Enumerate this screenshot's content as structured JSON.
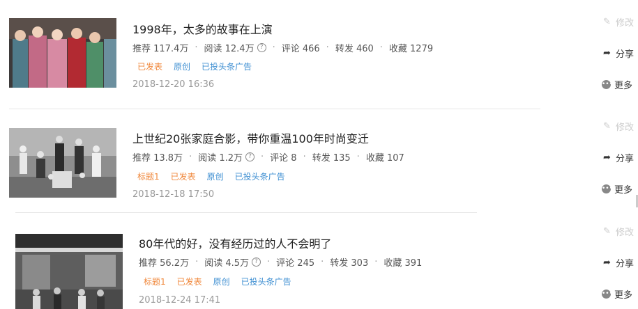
{
  "articles": [
    {
      "title": "1998年，太多的故事在上演",
      "stats": {
        "recommend": "推荐 117.4万",
        "read": "阅读 12.4万",
        "comment": "评论 466",
        "forward": "转发 460",
        "favorite": "收藏 1279"
      },
      "tags": [
        "已发表",
        "原创",
        "已投头条广告"
      ],
      "tag_colors": [
        "orange",
        "blue",
        "blue"
      ],
      "date": "2018-12-20 16:36"
    },
    {
      "title": "上世纪20张家庭合影，带你重温100年时尚变迁",
      "stats": {
        "recommend": "推荐 13.8万",
        "read": "阅读 1.2万",
        "comment": "评论 8",
        "forward": "转发 135",
        "favorite": "收藏 107"
      },
      "tags": [
        "标题1",
        "已发表",
        "原创",
        "已投头条广告"
      ],
      "tag_colors": [
        "orange",
        "orange",
        "blue",
        "blue"
      ],
      "date": "2018-12-18 17:50"
    },
    {
      "title": "80年代的好，没有经历过的人不会明了",
      "stats": {
        "recommend": "推荐 56.2万",
        "read": "阅读 4.5万",
        "comment": "评论 245",
        "forward": "转发 303",
        "favorite": "收藏 391"
      },
      "tags": [
        "标题1",
        "已发表",
        "原创",
        "已投头条广告"
      ],
      "tag_colors": [
        "orange",
        "orange",
        "blue",
        "blue"
      ],
      "date": "2018-12-24 17:41"
    }
  ],
  "actions": {
    "edit": "修改",
    "share": "分享",
    "more": "更多"
  },
  "icons": {
    "edit": "pencil-icon",
    "share": "share-arrow-icon",
    "more": "more-dots-icon",
    "help": "question-circle-icon"
  },
  "colors": {
    "tag_orange": "#f0883c",
    "tag_blue": "#3f8fd2",
    "date_gray": "#999999"
  }
}
